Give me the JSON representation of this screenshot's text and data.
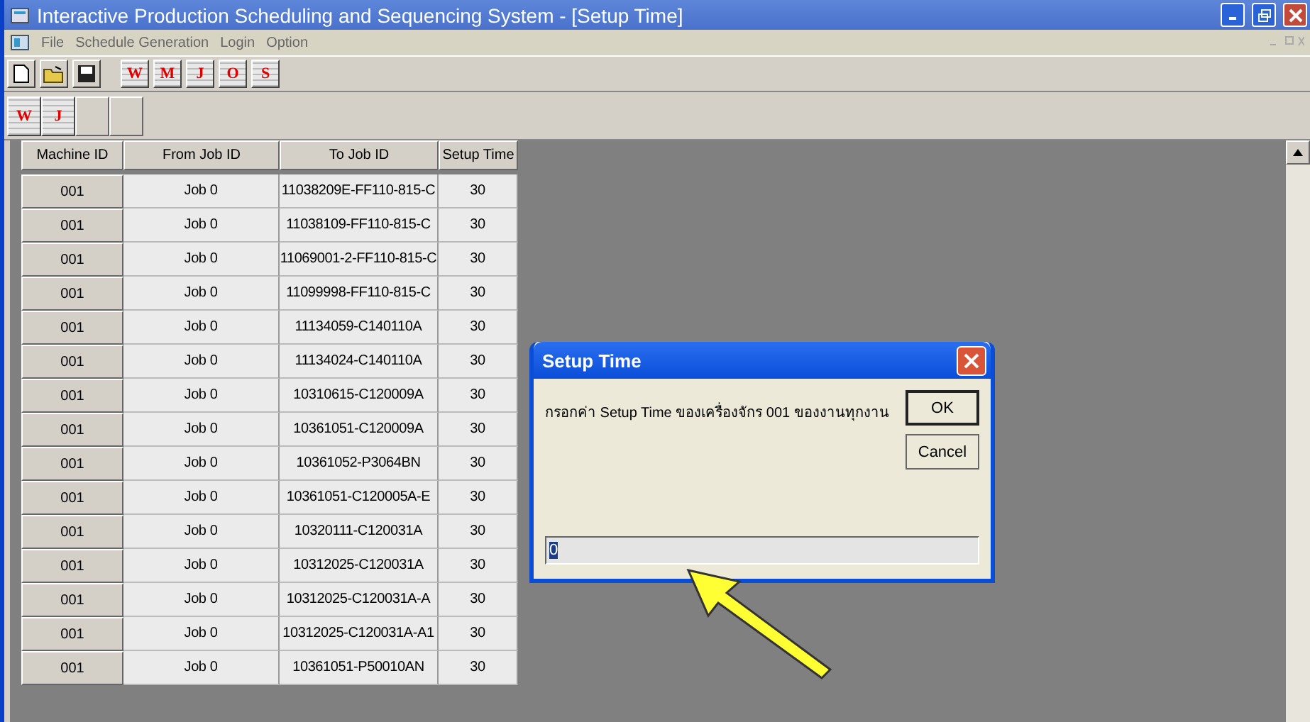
{
  "window": {
    "title": "Interactive Production Scheduling and Sequencing System - [Setup Time]"
  },
  "menu_bar": {
    "items": [
      "File",
      "Schedule Generation",
      "Login",
      "Option"
    ]
  },
  "toolbar": {
    "buttons": [
      {
        "kind": "new"
      },
      {
        "kind": "open"
      },
      {
        "kind": "save"
      },
      {
        "kind": "letter",
        "label": "W"
      },
      {
        "kind": "letter",
        "label": "M"
      },
      {
        "kind": "letter",
        "label": "J"
      },
      {
        "kind": "letter",
        "label": "O"
      },
      {
        "kind": "letter",
        "label": "S"
      }
    ]
  },
  "toolbar_2": {
    "buttons": [
      {
        "kind": "letter",
        "label": "W"
      },
      {
        "kind": "letter",
        "label": "J"
      },
      {
        "kind": "blank"
      },
      {
        "kind": "blank"
      }
    ]
  },
  "table": {
    "columns": [
      "Machine ID",
      "From Job ID",
      "To Job ID",
      "Setup Time"
    ],
    "rows": [
      [
        "001",
        "Job 0",
        "11038209E-FF110-815-C",
        "30"
      ],
      [
        "001",
        "Job 0",
        "11038109-FF110-815-C",
        "30"
      ],
      [
        "001",
        "Job 0",
        "11069001-2-FF110-815-C",
        "30"
      ],
      [
        "001",
        "Job 0",
        "11099998-FF110-815-C",
        "30"
      ],
      [
        "001",
        "Job 0",
        "11134059-C140110A",
        "30"
      ],
      [
        "001",
        "Job 0",
        "11134024-C140110A",
        "30"
      ],
      [
        "001",
        "Job 0",
        "10310615-C120009A",
        "30"
      ],
      [
        "001",
        "Job 0",
        "10361051-C120009A",
        "30"
      ],
      [
        "001",
        "Job 0",
        "10361052-P3064BN",
        "30"
      ],
      [
        "001",
        "Job 0",
        "10361051-C120005A-E",
        "30"
      ],
      [
        "001",
        "Job 0",
        "10320111-C120031A",
        "30"
      ],
      [
        "001",
        "Job 0",
        "10312025-C120031A",
        "30"
      ],
      [
        "001",
        "Job 0",
        "10312025-C120031A-A",
        "30"
      ],
      [
        "001",
        "Job 0",
        "10312025-C120031A-A1",
        "30"
      ],
      [
        "001",
        "Job 0",
        "10361051-P50010AN",
        "30"
      ]
    ]
  },
  "dialog": {
    "title": "Setup Time",
    "message": "กรอกค่า Setup Time ของเครื่องจักร 001 ของงานทุกงาน",
    "buttons": [
      "OK",
      "Cancel"
    ],
    "input_value": "0"
  }
}
